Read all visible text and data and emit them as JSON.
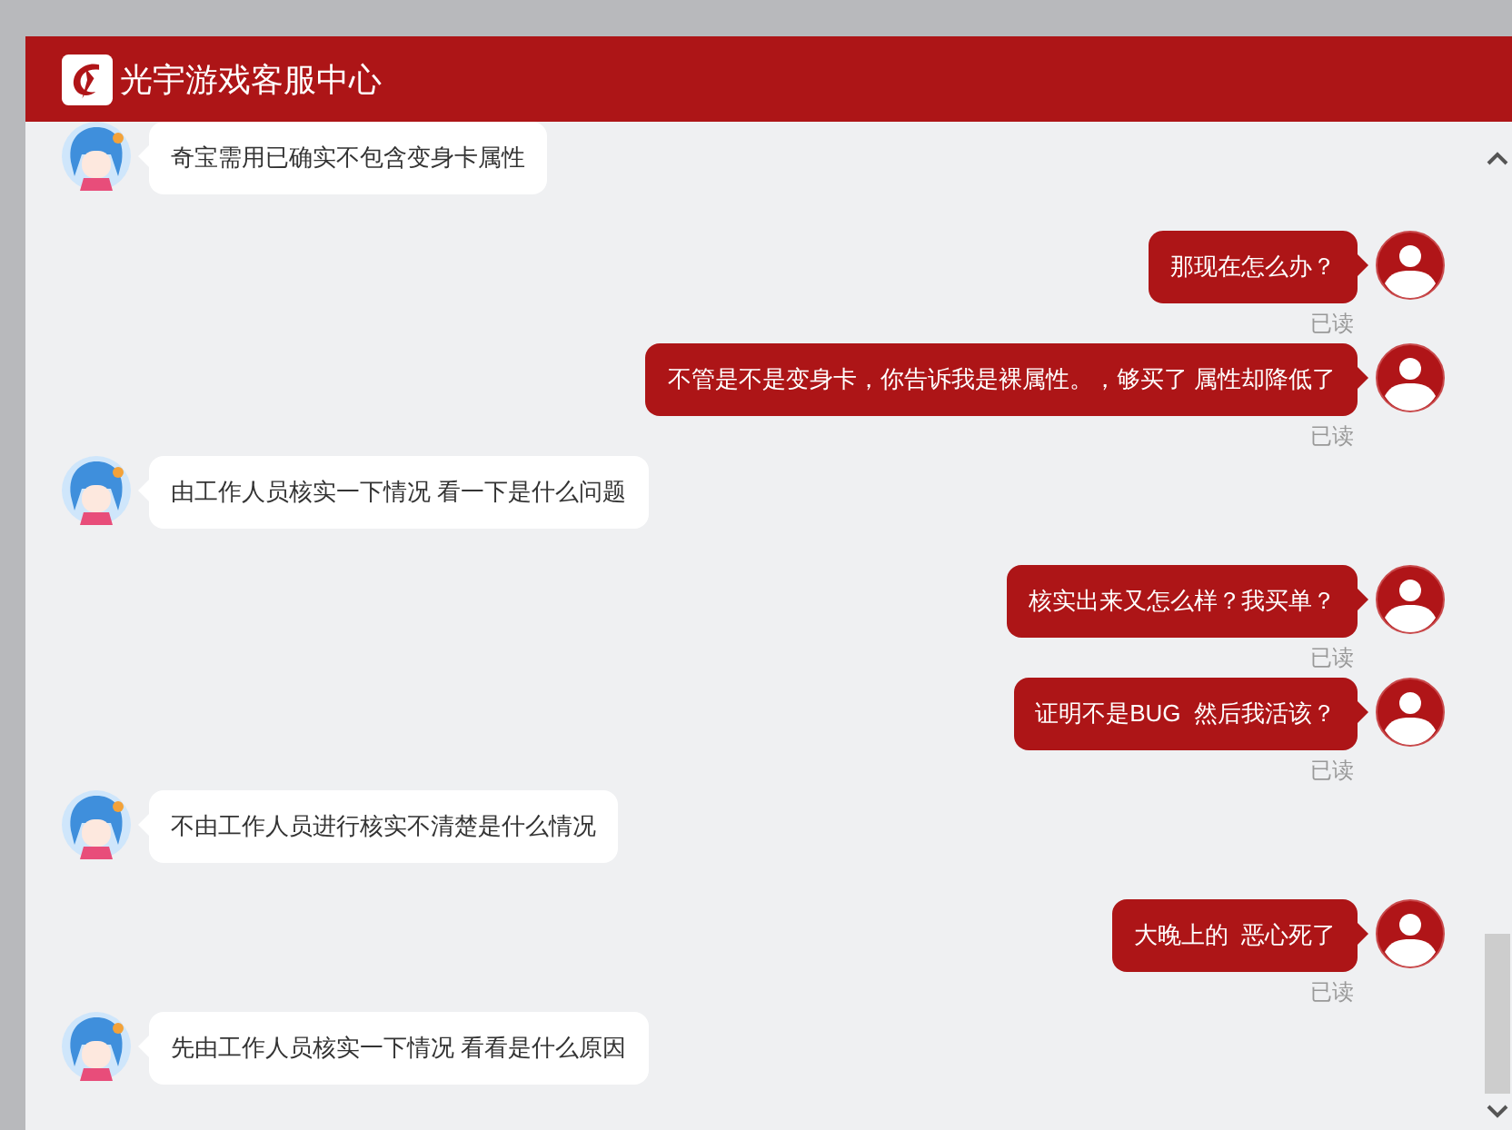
{
  "header": {
    "title": "光宇游戏客服中心"
  },
  "messages": [
    {
      "kind": "agent",
      "text": "奇宝需用已确实不包含变身卡属性"
    },
    {
      "kind": "user",
      "text": "那现在怎么办？",
      "status": "已读"
    },
    {
      "kind": "user",
      "text": "不管是不是变身卡，你告诉我是裸属性。，够买了 属性却降低了",
      "status": "已读"
    },
    {
      "kind": "agent",
      "text": "由工作人员核实一下情况 看一下是什么问题"
    },
    {
      "kind": "user",
      "text": "核实出来又怎么样？我买单？",
      "status": "已读"
    },
    {
      "kind": "user",
      "text": "证明不是BUG  然后我活该？",
      "status": "已读"
    },
    {
      "kind": "agent",
      "text": "不由工作人员进行核实不清楚是什么情况"
    },
    {
      "kind": "user",
      "text": "大晚上的  恶心死了",
      "status": "已读"
    },
    {
      "kind": "agent",
      "text": "先由工作人员核实一下情况 看看是什么原因"
    }
  ]
}
